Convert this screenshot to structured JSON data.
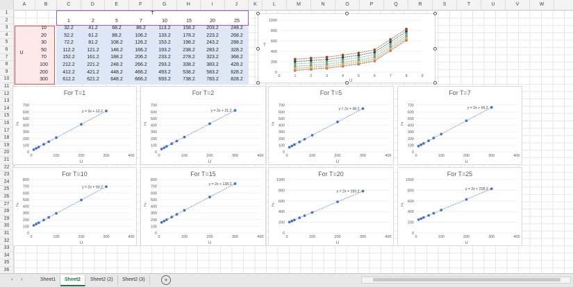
{
  "columns": [
    "A",
    "B",
    "C",
    "D",
    "E",
    "F",
    "G",
    "H",
    "I",
    "J",
    "K",
    "L",
    "M",
    "N",
    "O",
    "P",
    "Q",
    "R",
    "S",
    "T",
    "U",
    "V",
    "W"
  ],
  "rows": [
    "1",
    "2",
    "3",
    "4",
    "5",
    "6",
    "7",
    "8",
    "9",
    "10",
    "11",
    "12",
    "13",
    "14",
    "15",
    "16",
    "17",
    "18",
    "19",
    "20",
    "21",
    "22",
    "23",
    "24",
    "25",
    "26",
    "27",
    "28",
    "29",
    "30",
    "31",
    "32",
    "33",
    "34",
    "35",
    "36"
  ],
  "table": {
    "t_label": "T",
    "u_label": "U",
    "t_values": [
      "1",
      "2",
      "5",
      "7",
      "10",
      "15",
      "20",
      "25"
    ],
    "u_values": [
      "10",
      "20",
      "30",
      "50",
      "70",
      "100",
      "200",
      "300"
    ],
    "cells": [
      [
        "32.2",
        "41.2",
        "68.2",
        "86.2",
        "113.2",
        "158.2",
        "203.2",
        "248.2"
      ],
      [
        "52.2",
        "61.2",
        "88.2",
        "106.2",
        "133.2",
        "178.2",
        "223.2",
        "268.2"
      ],
      [
        "72.2",
        "81.2",
        "108.2",
        "126.2",
        "153.2",
        "198.2",
        "243.2",
        "288.2"
      ],
      [
        "112.2",
        "121.2",
        "148.2",
        "166.2",
        "193.2",
        "238.2",
        "283.2",
        "328.2"
      ],
      [
        "152.2",
        "161.2",
        "188.2",
        "206.2",
        "233.2",
        "278.2",
        "323.2",
        "368.2"
      ],
      [
        "212.2",
        "221.2",
        "248.2",
        "266.2",
        "293.2",
        "338.2",
        "383.2",
        "428.2"
      ],
      [
        "412.2",
        "421.2",
        "448.2",
        "466.2",
        "493.2",
        "538.2",
        "583.2",
        "628.2"
      ],
      [
        "612.2",
        "621.2",
        "648.2",
        "666.2",
        "693.2",
        "738.2",
        "783.2",
        "828.2"
      ]
    ]
  },
  "chart_data": [
    {
      "type": "line",
      "ylabel": "T",
      "xlabel": "U",
      "x": [
        1,
        2,
        3,
        4,
        5,
        6,
        7,
        8
      ],
      "ylim": [
        0,
        1000
      ],
      "xlim": [
        0,
        9
      ],
      "yticks": [
        "0",
        "200",
        "400",
        "600",
        "800",
        "1000"
      ],
      "xticks": [
        "0",
        "1",
        "2",
        "3",
        "4",
        "5",
        "6",
        "7",
        "8",
        "9"
      ],
      "series": [
        {
          "color": "#4472c4",
          "values": [
            32.2,
            52.2,
            72.2,
            112.2,
            152.2,
            212.2,
            412.2,
            612.2
          ]
        },
        {
          "color": "#ed7d31",
          "values": [
            41.2,
            61.2,
            81.2,
            121.2,
            161.2,
            221.2,
            421.2,
            621.2
          ]
        },
        {
          "color": "#a5a5a5",
          "values": [
            68.2,
            88.2,
            108.2,
            148.2,
            188.2,
            248.2,
            448.2,
            648.2
          ]
        },
        {
          "color": "#ffc000",
          "values": [
            86.2,
            106.2,
            126.2,
            166.2,
            206.2,
            266.2,
            466.2,
            666.2
          ]
        },
        {
          "color": "#5b9bd5",
          "values": [
            113.2,
            133.2,
            153.2,
            193.2,
            233.2,
            293.2,
            493.2,
            693.2
          ]
        },
        {
          "color": "#70ad47",
          "values": [
            158.2,
            178.2,
            198.2,
            238.2,
            278.2,
            338.2,
            538.2,
            738.2
          ]
        },
        {
          "color": "#264478",
          "values": [
            203.2,
            223.2,
            243.2,
            283.2,
            323.2,
            383.2,
            583.2,
            783.2
          ]
        },
        {
          "color": "#9e480e",
          "values": [
            248.2,
            268.2,
            288.2,
            328.2,
            368.2,
            428.2,
            628.2,
            828.2
          ]
        }
      ]
    },
    {
      "type": "scatter",
      "title": "For T=1",
      "xlabel": "U",
      "ylabel": "Z",
      "equation": "y = 2x + 12.2",
      "ylim": [
        0,
        800
      ],
      "xlim": [
        0,
        400
      ],
      "yticks": [
        "0",
        "100",
        "200",
        "300",
        "400",
        "500",
        "600",
        "700"
      ],
      "xticks": [
        "0",
        "100",
        "200",
        "300",
        "400"
      ],
      "x": [
        10,
        20,
        30,
        50,
        70,
        100,
        200,
        300
      ],
      "y": [
        32.2,
        52.2,
        72.2,
        112.2,
        152.2,
        212.2,
        412.2,
        612.2
      ]
    },
    {
      "type": "scatter",
      "title": "For T=2",
      "xlabel": "U",
      "ylabel": "Z",
      "equation": "y = 2x + 21.2",
      "ylim": [
        0,
        800
      ],
      "xlim": [
        0,
        400
      ],
      "yticks": [
        "0",
        "100",
        "200",
        "300",
        "400",
        "500",
        "600",
        "700"
      ],
      "xticks": [
        "0",
        "100",
        "200",
        "300",
        "400"
      ],
      "x": [
        10,
        20,
        30,
        50,
        70,
        100,
        200,
        300
      ],
      "y": [
        41.2,
        61.2,
        81.2,
        121.2,
        161.2,
        221.2,
        421.2,
        621.2
      ]
    },
    {
      "type": "scatter",
      "title": "For T=5",
      "xlabel": "U",
      "ylabel": "Z",
      "equation": "y = 2x + 48.2",
      "ylim": [
        0,
        800
      ],
      "xlim": [
        0,
        400
      ],
      "yticks": [
        "0",
        "100",
        "200",
        "300",
        "400",
        "500",
        "600",
        "700"
      ],
      "xticks": [
        "0",
        "100",
        "200",
        "300",
        "400"
      ],
      "x": [
        10,
        20,
        30,
        50,
        70,
        100,
        200,
        300
      ],
      "y": [
        68.2,
        88.2,
        108.2,
        148.2,
        188.2,
        248.2,
        448.2,
        648.2
      ]
    },
    {
      "type": "scatter",
      "title": "For T=7",
      "xlabel": "U",
      "ylabel": "Z",
      "equation": "y = 2x + 66.2",
      "ylim": [
        0,
        800
      ],
      "xlim": [
        0,
        400
      ],
      "yticks": [
        "0",
        "100",
        "200",
        "300",
        "400",
        "500",
        "600",
        "700"
      ],
      "xticks": [
        "0",
        "100",
        "200",
        "300",
        "400"
      ],
      "x": [
        10,
        20,
        30,
        50,
        70,
        100,
        200,
        300
      ],
      "y": [
        86.2,
        106.2,
        126.2,
        166.2,
        206.2,
        266.2,
        466.2,
        666.2
      ]
    },
    {
      "type": "scatter",
      "title": "For T=10",
      "xlabel": "U",
      "ylabel": "Z",
      "equation": "y = 2x + 93.2",
      "ylim": [
        0,
        800
      ],
      "xlim": [
        0,
        400
      ],
      "yticks": [
        "0",
        "100",
        "200",
        "300",
        "400",
        "500",
        "600",
        "700",
        "800"
      ],
      "xticks": [
        "0",
        "100",
        "200",
        "300",
        "400"
      ],
      "x": [
        10,
        20,
        30,
        50,
        70,
        100,
        200,
        300
      ],
      "y": [
        113.2,
        133.2,
        153.2,
        193.2,
        233.2,
        293.2,
        493.2,
        693.2
      ]
    },
    {
      "type": "scatter",
      "title": "For T=15",
      "xlabel": "U",
      "ylabel": "Z",
      "equation": "y = 2x + 138.2",
      "ylim": [
        0,
        800
      ],
      "xlim": [
        0,
        400
      ],
      "yticks": [
        "0",
        "100",
        "200",
        "300",
        "400",
        "500",
        "600",
        "700",
        "800"
      ],
      "xticks": [
        "0",
        "100",
        "200",
        "300",
        "400"
      ],
      "x": [
        10,
        20,
        30,
        50,
        70,
        100,
        200,
        300
      ],
      "y": [
        158.2,
        178.2,
        198.2,
        238.2,
        278.2,
        338.2,
        538.2,
        738.2
      ]
    },
    {
      "type": "scatter",
      "title": "For T=20",
      "xlabel": "U",
      "ylabel": "Z",
      "equation": "y = 2x + 183.2",
      "ylim": [
        0,
        1000
      ],
      "xlim": [
        0,
        400
      ],
      "yticks": [
        "0",
        "200",
        "400",
        "600",
        "800",
        "1000"
      ],
      "xticks": [
        "0",
        "100",
        "200",
        "300",
        "400"
      ],
      "x": [
        10,
        20,
        30,
        50,
        70,
        100,
        200,
        300
      ],
      "y": [
        203.2,
        223.2,
        243.2,
        283.2,
        323.2,
        383.2,
        583.2,
        783.2
      ]
    },
    {
      "type": "scatter",
      "title": "For T=25",
      "xlabel": "U",
      "ylabel": "Z",
      "equation": "y = 2x + 228.2",
      "ylim": [
        0,
        1000
      ],
      "xlim": [
        0,
        400
      ],
      "yticks": [
        "0",
        "200",
        "400",
        "600",
        "800",
        "1000"
      ],
      "xticks": [
        "0",
        "100",
        "200",
        "300",
        "400"
      ],
      "x": [
        10,
        20,
        30,
        50,
        70,
        100,
        200,
        300
      ],
      "y": [
        248.2,
        268.2,
        288.2,
        328.2,
        368.2,
        428.2,
        628.2,
        828.2
      ]
    }
  ],
  "sheets": {
    "tabs": [
      "Sheet1",
      "Sheet2",
      "Sheet2 (2)",
      "Sheet2 (3)"
    ],
    "active": "Sheet2",
    "add_symbol": "+",
    "nav_prev": "‹",
    "nav_next": "›"
  },
  "colors": {
    "accent": "#217346",
    "marker": "#4472c4",
    "t_border": "#9b59b6",
    "u_border": "#d9534f"
  }
}
